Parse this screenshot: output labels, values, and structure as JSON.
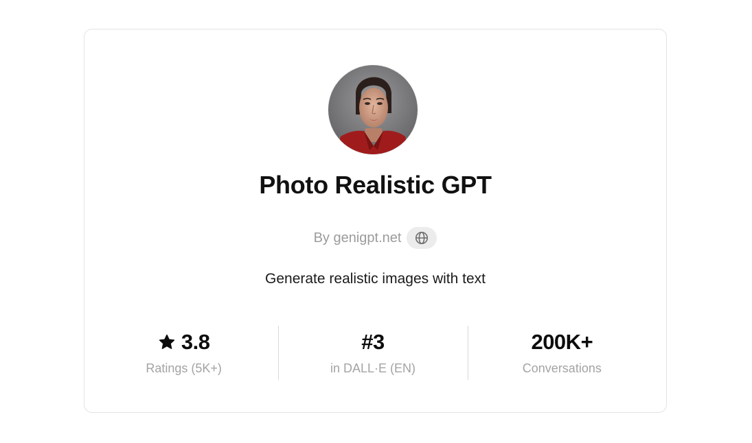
{
  "gpt": {
    "name": "Photo Realistic GPT",
    "byline": "By genigpt.net",
    "description": "Generate realistic images with text",
    "avatar_alt": "Photo Realistic GPT avatar",
    "website_icon": "globe-icon"
  },
  "stats": [
    {
      "value": "3.8",
      "label": "Ratings (5K+)",
      "icon": "star-icon"
    },
    {
      "value": "#3",
      "label": "in DALL·E (EN)"
    },
    {
      "value": "200K+",
      "label": "Conversations"
    }
  ],
  "colors": {
    "border": "#e3e3e3",
    "muted_text": "#9b9b9b",
    "pill_bg": "#ececec",
    "divider": "#d9d9d9"
  }
}
